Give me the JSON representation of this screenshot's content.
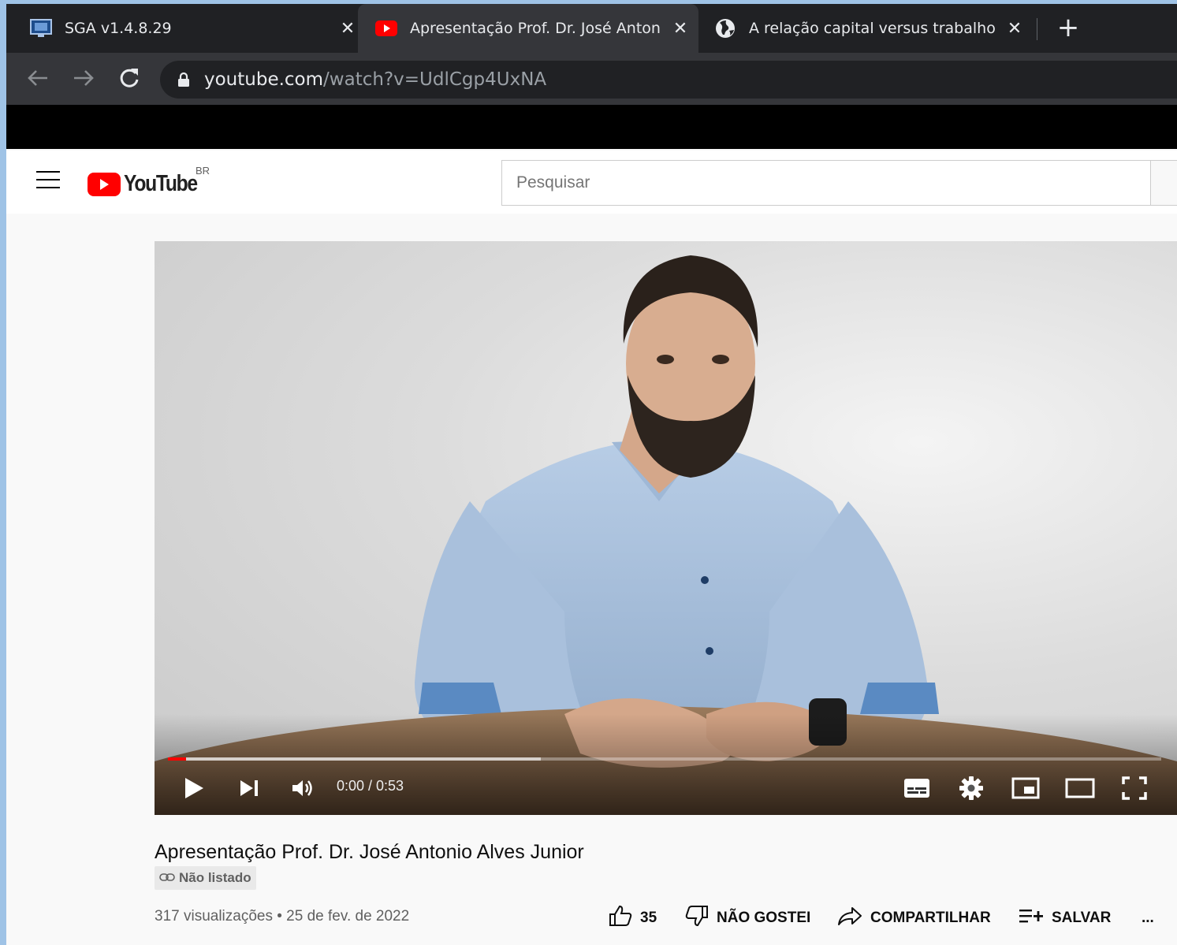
{
  "browser": {
    "tabs": [
      {
        "title": "SGA v1.4.8.29",
        "favicon": "monitor-icon",
        "active": false
      },
      {
        "title": "Apresentação Prof. Dr. José Antonio Alves Junior",
        "favicon": "youtube-icon",
        "active": true
      },
      {
        "title": "A relação capital versus trabalho",
        "favicon": "globe-icon",
        "active": false
      }
    ],
    "new_tab": "+",
    "url_host": "youtube.com",
    "url_path": "/watch?v=UdlCgp4UxNA"
  },
  "youtube": {
    "logo_text": "YouTube",
    "country_code": "BR",
    "search_placeholder": "Pesquisar"
  },
  "player": {
    "time": "0:00 / 0:53",
    "progress_played_fraction": 0.018,
    "progress_buffered_fraction": 0.375
  },
  "video": {
    "title": "Apresentação Prof. Dr. José Antonio Alves Junior",
    "visibility": "Não listado",
    "views_date": "317 visualizações • 25 de fev. de 2022",
    "likes": "35",
    "dislike_label": "NÃO GOSTEI",
    "share_label": "COMPARTILHAR",
    "save_label": "SALVAR",
    "more_label": "..."
  },
  "colors": {
    "youtube_red": "#ff0000",
    "chrome_dark": "#202124",
    "chrome_toolbar": "#35363a"
  }
}
